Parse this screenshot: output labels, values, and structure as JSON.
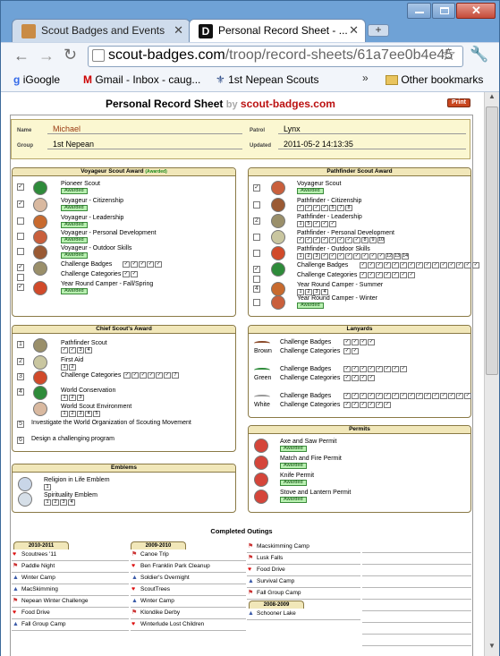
{
  "browser": {
    "tabs": [
      {
        "label": "Scout Badges and Events"
      },
      {
        "label": "Personal Record Sheet - ..."
      }
    ],
    "url": {
      "host": "scout-badges.com",
      "path": "/troop/record-sheets/61a7ee0b4e45"
    },
    "bookmarks": [
      "iGoogle",
      "Gmail - Inbox - caug...",
      "1st Nepean Scouts"
    ],
    "other_bookmarks": "Other bookmarks",
    "overflow": "»"
  },
  "sheet": {
    "title": "Personal Record Sheet",
    "by": "by",
    "site": "scout-badges.com",
    "print_label": "Print",
    "name_label": "Name",
    "name": "Michael",
    "group_label": "Group",
    "group": "1st Nepean",
    "patrol_label": "Patrol",
    "patrol": "Lynx",
    "updated_label": "Updated",
    "updated": "2011-05-2 14:13:35"
  },
  "voyageur": {
    "title": "Voyageur Scout Award",
    "title_note": "(Awarded)",
    "items": [
      {
        "label": "Pioneer Scout",
        "award": "Awarded",
        "check": "✓"
      },
      {
        "label": "Voyageur - Citizenship",
        "award": "Awarded",
        "check": "✓"
      },
      {
        "label": "Voyageur - Leadership",
        "award": "Awarded",
        "check": ""
      },
      {
        "label": "Voyageur - Personal Development",
        "award": "Awarded",
        "check": ""
      },
      {
        "label": "Voyageur - Outdoor Skills",
        "award": "Awarded",
        "check": ""
      },
      {
        "label": "Challenge Badges",
        "boxes": [
          "✓",
          "✓",
          "✓",
          "✓",
          "✓"
        ],
        "check": "✓"
      },
      {
        "label": "Challenge Categories",
        "boxes": [
          "✓",
          "✓"
        ],
        "check": ""
      },
      {
        "label": "Year Round Camper - Fall/Spring",
        "award": "Awarded",
        "check": "✓"
      }
    ]
  },
  "pathfinder": {
    "title": "Pathfinder Scout Award",
    "items": [
      {
        "label": "Voyageur Scout",
        "award": "Awarded",
        "check": "✓"
      },
      {
        "label": "Pathfinder - Citizenship",
        "boxes": [
          "✓",
          "✓",
          "✓",
          "✓",
          "5",
          "7",
          "8"
        ],
        "check": ""
      },
      {
        "label": "Pathfinder - Leadership",
        "boxes": [
          "1",
          "5",
          "✓",
          "✓",
          "✓"
        ],
        "check": "2"
      },
      {
        "label": "Pathfinder - Personal Development",
        "boxes": [
          "✓",
          "✓",
          "✓",
          "✓",
          "✓",
          "✓",
          "✓",
          "✓",
          "8",
          "9",
          "10"
        ],
        "check": ""
      },
      {
        "label": "Pathfinder - Outdoor Skills",
        "boxes": [
          "1",
          "2",
          "3",
          "✓",
          "✓",
          "✓",
          "✓",
          "✓",
          "✓",
          "✓",
          "✓",
          "12",
          "13",
          "14"
        ],
        "check": ""
      },
      {
        "label": "Challenge Badges",
        "boxes": [
          "✓",
          "✓",
          "✓",
          "✓",
          "✓",
          "✓",
          "✓",
          "✓",
          "✓",
          "✓",
          "✓",
          "✓",
          "✓",
          "✓",
          "✓"
        ],
        "check": "✓"
      },
      {
        "label": "Challenge Categories",
        "boxes": [
          "✓",
          "✓",
          "✓",
          "✓",
          "✓",
          "✓",
          "✓"
        ],
        "check": ""
      },
      {
        "label": "Year Round Camper - Summer",
        "boxes": [
          "1",
          "2",
          "3",
          "4"
        ],
        "check": "4"
      },
      {
        "label": "Year Round Camper - Winter",
        "award": "Awarded",
        "check": ""
      }
    ]
  },
  "chief": {
    "title": "Chief Scout's Award",
    "items": [
      {
        "num": "1",
        "label": "Pathfinder Scout",
        "boxes": [
          "✓",
          "✓",
          "3",
          "4"
        ]
      },
      {
        "num": "2",
        "label": "First Aid",
        "boxes": [
          "1",
          "2"
        ]
      },
      {
        "num": "3",
        "label": "Challenge Categories",
        "boxes": [
          "✓",
          "✓",
          "✓",
          "✓",
          "✓",
          "✓",
          "7"
        ]
      },
      {
        "num": "4",
        "label": "World Conservation",
        "boxes": [
          "1",
          "2",
          "3"
        ]
      },
      {
        "num": "",
        "label": "World Scout Environment",
        "boxes": [
          "1",
          "2",
          "3",
          "4",
          "5"
        ]
      },
      {
        "num": "5",
        "label": "Investigate the World Organization of Scouting Movement",
        "boxes": []
      },
      {
        "num": "6",
        "label": "Design a challenging program",
        "boxes": []
      }
    ]
  },
  "lanyards": {
    "title": "Lanyards",
    "groups": [
      {
        "color": "Brown",
        "rows": [
          {
            "label": "Challenge Badges",
            "boxes": [
              "✓",
              "✓",
              "✓",
              "✓"
            ]
          },
          {
            "label": "Challenge Categories",
            "boxes": [
              "✓",
              "✓"
            ]
          }
        ]
      },
      {
        "color": "Green",
        "rows": [
          {
            "label": "Challenge Badges",
            "boxes": [
              "✓",
              "✓",
              "✓",
              "✓",
              "✓",
              "✓",
              "✓",
              "✓"
            ]
          },
          {
            "label": "Challenge Categories",
            "boxes": [
              "✓",
              "✓",
              "✓",
              "✓"
            ]
          }
        ]
      },
      {
        "color": "White",
        "rows": [
          {
            "label": "Challenge Badges",
            "boxes": [
              "✓",
              "✓",
              "✓",
              "✓",
              "✓",
              "✓",
              "✓",
              "✓",
              "✓",
              "✓",
              "✓",
              "✓",
              "✓",
              "✓",
              "✓",
              "✓"
            ]
          },
          {
            "label": "Challenge Categories",
            "boxes": [
              "✓",
              "✓",
              "✓",
              "✓",
              "✓",
              "✓"
            ]
          }
        ]
      }
    ]
  },
  "emblems": {
    "title": "Emblems",
    "items": [
      {
        "label": "Religion in Life Emblem",
        "boxes": [
          "1"
        ]
      },
      {
        "label": "Spirituality Emblem",
        "boxes": [
          "1",
          "2",
          "3",
          "4"
        ]
      }
    ]
  },
  "permits": {
    "title": "Permits",
    "items": [
      {
        "label": "Axe and Saw Permit",
        "award": "Awarded"
      },
      {
        "label": "Match and Fire Permit",
        "award": "Awarded"
      },
      {
        "label": "Knife Permit",
        "award": "Awarded"
      },
      {
        "label": "Stove and Lantern Permit",
        "award": "Awarded"
      }
    ]
  },
  "outings": {
    "title": "Completed Outings",
    "columns": [
      {
        "year": "2010-2011",
        "items": [
          {
            "icon": "heart",
            "label": "Scoutrees '11"
          },
          {
            "icon": "hiker",
            "label": "Paddle Night"
          },
          {
            "icon": "tent",
            "label": "Winter Camp"
          },
          {
            "icon": "tent",
            "label": "MacSkimming"
          },
          {
            "icon": "hiker",
            "label": "Nepean Winter Challenge"
          },
          {
            "icon": "heart",
            "label": "Food Drive"
          },
          {
            "icon": "tent",
            "label": "Fall Group Camp"
          }
        ]
      },
      {
        "year": "2009-2010",
        "items": [
          {
            "icon": "hiker",
            "label": "Canoe Trip"
          },
          {
            "icon": "heart",
            "label": "Ben Franklin Park Cleanup"
          },
          {
            "icon": "tent",
            "label": "Soldier's Overnight"
          },
          {
            "icon": "heart",
            "label": "ScoutTrees"
          },
          {
            "icon": "tent",
            "label": "Winter Camp"
          },
          {
            "icon": "hiker",
            "label": "Klondike Derby"
          },
          {
            "icon": "heart",
            "label": "Winterlude Lost Children"
          }
        ]
      },
      {
        "year": "",
        "items": [
          {
            "icon": "hiker",
            "label": "Macskimming Camp"
          },
          {
            "icon": "hiker",
            "label": "Lusk Falls"
          },
          {
            "icon": "heart",
            "label": "Food Drive"
          },
          {
            "icon": "tent",
            "label": "Survival Camp"
          },
          {
            "icon": "hiker",
            "label": "Fall Group Camp"
          }
        ]
      },
      {
        "year": "2008-2009",
        "items": [
          {
            "icon": "tent",
            "label": "Schooner Lake"
          }
        ]
      }
    ]
  },
  "colors": {
    "accent": "#c0392b",
    "award_bg": "#b8f0b0",
    "section_head": "#f1e7b9",
    "tab_bg": "#6fa2d6"
  }
}
